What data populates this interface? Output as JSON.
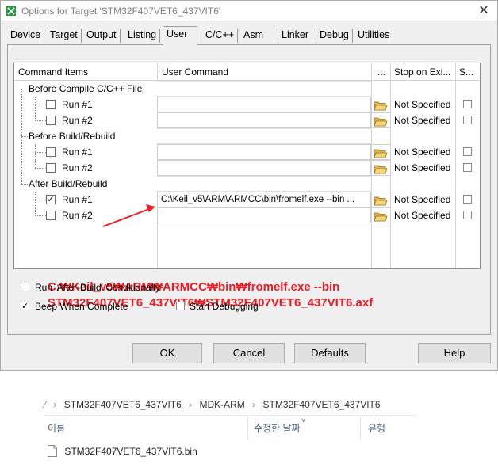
{
  "window": {
    "title": "Options for Target 'STM32F407VET6_437VIT6'",
    "close_label": "✕"
  },
  "tabs": [
    {
      "label": "Device"
    },
    {
      "label": "Target"
    },
    {
      "label": "Output"
    },
    {
      "label": "Listing"
    },
    {
      "label": "User"
    },
    {
      "label": "C/C++"
    },
    {
      "label": "Asm"
    },
    {
      "label": "Linker"
    },
    {
      "label": "Debug"
    },
    {
      "label": "Utilities"
    }
  ],
  "active_tab": "User",
  "grid": {
    "headers": {
      "items": "Command Items",
      "command": "User Command",
      "browse": "...",
      "stop": "Stop on Exi...",
      "s": "S..."
    },
    "groups": [
      {
        "label": "Before Compile C/C++ File",
        "runs": [
          {
            "label": "Run #1",
            "checked": false,
            "command": "",
            "stop": "Not Specified",
            "s_checked": false
          },
          {
            "label": "Run #2",
            "checked": false,
            "command": "",
            "stop": "Not Specified",
            "s_checked": false
          }
        ]
      },
      {
        "label": "Before Build/Rebuild",
        "runs": [
          {
            "label": "Run #1",
            "checked": false,
            "command": "",
            "stop": "Not Specified",
            "s_checked": false
          },
          {
            "label": "Run #2",
            "checked": false,
            "command": "",
            "stop": "Not Specified",
            "s_checked": false
          }
        ]
      },
      {
        "label": "After Build/Rebuild",
        "runs": [
          {
            "label": "Run #1",
            "checked": true,
            "command": "C:\\Keil_v5\\ARM\\ARMCC\\bin\\fromelf.exe --bin ...",
            "stop": "Not Specified",
            "s_checked": false
          },
          {
            "label": "Run #2",
            "checked": false,
            "command": "",
            "stop": "Not Specified",
            "s_checked": false
          }
        ]
      }
    ]
  },
  "annotation": {
    "line1": "C:₩Keil_v5₩ARM₩ARMCC₩bin₩fromelf.exe --bin",
    "line2": "STM32F407VET6_437VIT6₩STM32F407VET6_437VIT6.axf",
    "color": "#ee1c24"
  },
  "options": {
    "run_after_build": {
      "label": "Run 'After-Build' Conditionally",
      "checked": false
    },
    "beep": {
      "label": "Beep When Complete",
      "checked": true
    },
    "start_debugging": {
      "label": "Start Debugging",
      "checked": false
    }
  },
  "buttons": {
    "ok": "OK",
    "cancel": "Cancel",
    "defaults": "Defaults",
    "help": "Help"
  },
  "explorer": {
    "breadcrumb": [
      "STM32F407VET6_437VIT6",
      "MDK-ARM",
      "STM32F407VET6_437VIT6"
    ],
    "breadcrumb_lead": "⁄",
    "columns": {
      "name": "이름",
      "date": "수정한 날짜",
      "type": "유형"
    },
    "file": "STM32F407VET6_437VIT6.bin"
  }
}
